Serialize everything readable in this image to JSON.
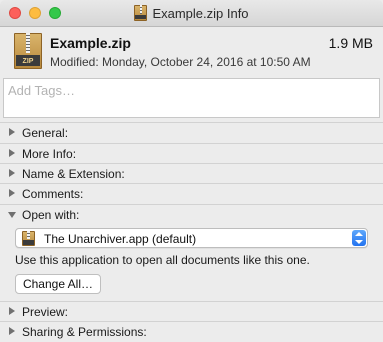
{
  "window": {
    "title": "Example.zip Info"
  },
  "file": {
    "name": "Example.zip",
    "size": "1.9 MB",
    "modified_label": "Modified:",
    "modified_value": "Monday, October 24, 2016 at 10:50 AM",
    "icon_text": "ZIP"
  },
  "tags": {
    "placeholder": "Add Tags…"
  },
  "sections": {
    "general": "General:",
    "more_info": "More Info:",
    "name_extension": "Name & Extension:",
    "comments": "Comments:",
    "open_with": "Open with:",
    "preview": "Preview:",
    "sharing": "Sharing & Permissions:"
  },
  "open_with": {
    "selected_app": "The Unarchiver.app (default)",
    "hint": "Use this application to open all documents like this one.",
    "change_all_label": "Change All…"
  },
  "icons": {
    "window_icon": "zip-file-icon",
    "app_icon": "unarchiver-app-icon",
    "disclosure": "disclosure-triangle-icon"
  },
  "colors": {
    "close": "#fc605b",
    "minimize": "#fdbc40",
    "maximize": "#34c84a",
    "accent": "#2373f0"
  }
}
